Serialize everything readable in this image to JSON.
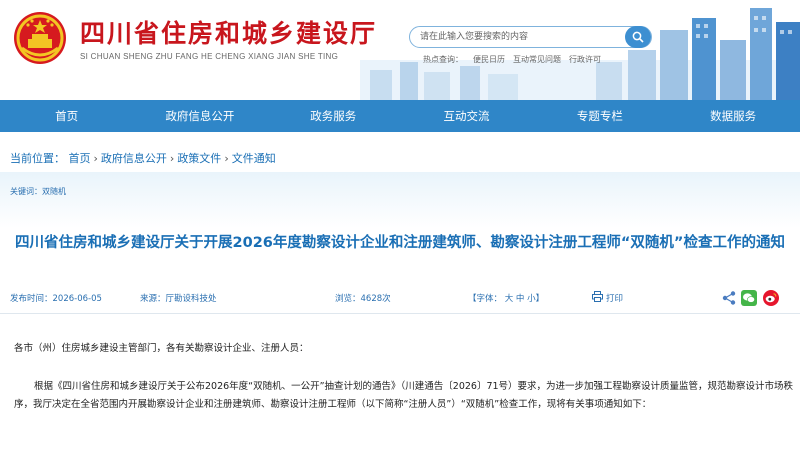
{
  "header": {
    "site_title": "四川省住房和城乡建设厅",
    "site_pinyin": "SI CHUAN SHENG ZHU FANG HE CHENG XIANG JIAN SHE TING",
    "search_placeholder": "请在此输入您要搜索的内容",
    "hot_label": "热点查询：",
    "hot_links": [
      "便民日历",
      "互动常见问题",
      "行政许可"
    ]
  },
  "nav": {
    "items": [
      "首页",
      "政府信息公开",
      "政务服务",
      "互动交流",
      "专题专栏",
      "数据服务"
    ]
  },
  "breadcrumb": {
    "prefix": "当前位置：",
    "items": [
      "首页",
      "政府信息公开",
      "政策文件",
      "文件通知"
    ],
    "separator": "›"
  },
  "article": {
    "keywords": "关键词：双随机",
    "title": "四川省住房和城乡建设厅关于开展2026年度勘察设计企业和注册建筑师、勘察设计注册工程师“双随机”检查工作的通知",
    "publish_date": "发布时间：2026-06-05",
    "source": "来源：厅勘设科技处",
    "views": "浏览：4628次",
    "font_size_label": "【字体： 大 中 小】",
    "print_label": "打印",
    "paragraphs": [
      "各市（州）住房城乡建设主管部门，各有关勘察设计企业、注册人员：",
      "根据《四川省住房和城乡建设厅关于公布2026年度“双随机、一公开”抽查计划的通告》（川建通告〔2026〕71号）要求，为进一步加强工程勘察设计质量监管，规范勘察设计市场秩序，我厅决定在全省范围内开展勘察设计企业和注册建筑师、勘察设计注册工程师（以下简称“注册人员”）“双随机”检查工作，现将有关事项通知如下："
    ]
  },
  "colors": {
    "brand_red": "#c8161d",
    "nav_blue": "#2f86c8",
    "link_blue": "#1a6fb5"
  },
  "icons": [
    "national-emblem-icon",
    "search-icon",
    "print-icon",
    "share-icon",
    "wechat-icon",
    "weibo-icon"
  ]
}
